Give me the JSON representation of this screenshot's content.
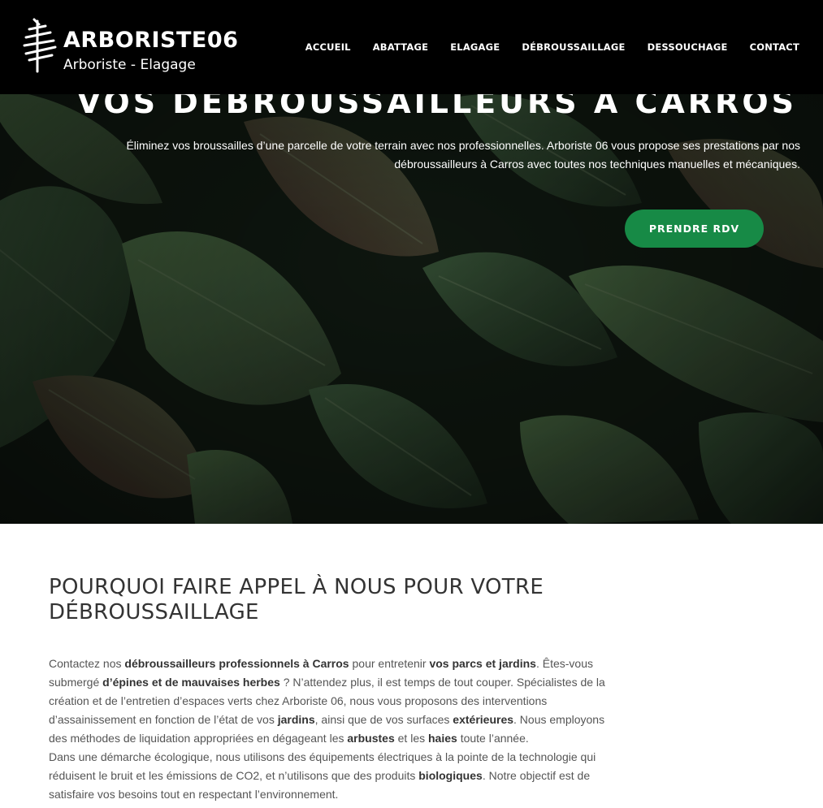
{
  "brand": {
    "name": "ARBORISTE06",
    "tagline": "Arboriste - Elagage"
  },
  "nav": {
    "items": [
      {
        "label": "ACCUEIL"
      },
      {
        "label": "ABATTAGE"
      },
      {
        "label": "ELAGAGE"
      },
      {
        "label": "DÉBROUSSAILLAGE"
      },
      {
        "label": "DESSOUCHAGE"
      },
      {
        "label": "CONTACT"
      }
    ]
  },
  "hero": {
    "title": "VOS DEBROUSSAILLEURS A CARROS",
    "description": "Éliminez vos broussailles d’une parcelle de votre terrain avec nos professionnelles. Arboriste 06 vous propose ses prestations par nos débroussailleurs à Carros avec toutes nos techniques manuelles et mécaniques.",
    "cta_label": "PRENDRE RDV"
  },
  "section": {
    "title": "POURQUOI FAIRE APPEL À NOUS POUR VOTRE DÉBROUSSAILLAGE",
    "p1": [
      "Contactez nos ",
      "débroussailleurs professionnels à Carros",
      " pour entretenir ",
      "vos parcs et jardins",
      ". Êtes-vous submergé ",
      "d’épines et de mauvaises herbes",
      " ? N’attendez plus, il est temps de tout couper. Spécialistes de la création et de l’entretien d’espaces verts chez Arboriste 06, nous vous proposons des interventions d’assainissement en fonction de l’état de vos ",
      "jardins",
      ", ainsi que de vos surfaces ",
      "extérieures",
      ". Nous employons des méthodes de liquidation appropriées en dégageant les ",
      "arbustes",
      " et les ",
      "haies",
      " toute l’année."
    ],
    "p2": [
      "Dans une démarche écologique, nous utilisons des équipements électriques à la pointe de la technologie qui réduisent le bruit et les émissions de CO2, et n’utilisons que des produits ",
      "biologiques",
      ". Notre objectif est de satisfaire vos besoins tout en respectant l’environnement."
    ]
  },
  "colors": {
    "header_bg": "#000000",
    "accent_green": "#178a46",
    "heading_text": "#333333",
    "body_text": "#555555"
  }
}
